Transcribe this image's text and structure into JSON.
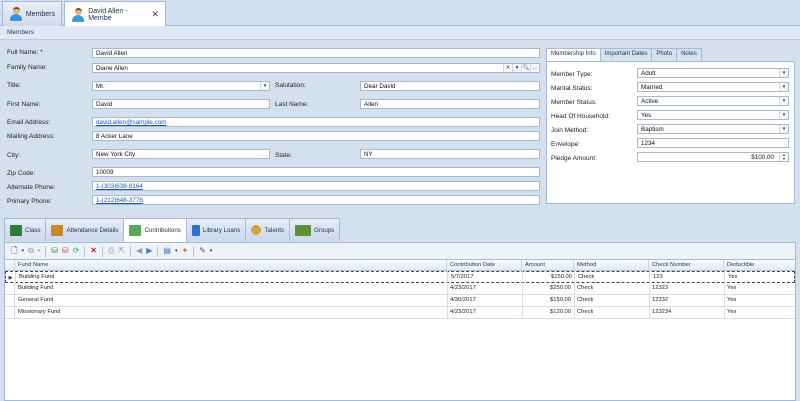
{
  "doc_tabs": [
    {
      "label": "Members",
      "closable": false
    },
    {
      "label": "David Allen - Membe",
      "closable": true,
      "close_glyph": "✕"
    }
  ],
  "breadcrumb": "Members",
  "form": {
    "full_name": {
      "label": "Full Name: *",
      "value": "David Allen"
    },
    "family_name": {
      "label": "Family Name:",
      "value": "Diane Allen",
      "buttons": [
        "✕",
        "▾",
        "🔍",
        "…"
      ]
    },
    "title": {
      "label": "Title:",
      "value": "Mr."
    },
    "salutation": {
      "label": "Salutation:",
      "value": "Dear David"
    },
    "first_name": {
      "label": "First Name:",
      "value": "David"
    },
    "last_name": {
      "label": "Last Name:",
      "value": "Allen"
    },
    "email": {
      "label": "Email Address:",
      "value": "david.allen@sample.com"
    },
    "mailing": {
      "label": "Mailing Address:",
      "value": "8 Acker Lane"
    },
    "city": {
      "label": "City:",
      "value": "New York City"
    },
    "state": {
      "label": "State:",
      "value": "NY"
    },
    "zip": {
      "label": "Zip Code:",
      "value": "10009"
    },
    "alt_phone": {
      "label": "Alternate Phone:",
      "value": "1-(303)638-8164"
    },
    "primary_phone": {
      "label": "Primary Phone:",
      "value": "1-(212)648-3778"
    }
  },
  "membership_tabs": [
    "Membership Info",
    "Important Dates",
    "Photo",
    "Notes"
  ],
  "membership": {
    "member_type": {
      "label": "Member Type:",
      "value": "Adult"
    },
    "marital_status": {
      "label": "Marital Status:",
      "value": "Married"
    },
    "member_status": {
      "label": "Member Status:",
      "value": "Active"
    },
    "head_of_household": {
      "label": "Head Of Household:",
      "value": "Yes"
    },
    "join_method": {
      "label": "Join Method:",
      "value": "Baptism"
    },
    "envelope": {
      "label": "Envelope:",
      "value": "1234"
    },
    "pledge_amount": {
      "label": "Pledge Amount:",
      "value": "$100.00"
    }
  },
  "sub_tabs": [
    {
      "label": "Class",
      "icon": "class-icon",
      "color": "#2f7d3a"
    },
    {
      "label": "Attendance Details",
      "icon": "attendance-icon",
      "color": "#c78a2a"
    },
    {
      "label": "Contributions",
      "icon": "contributions-icon",
      "color": "#58a85a"
    },
    {
      "label": "Library Loans",
      "icon": "library-icon",
      "color": "#2f6fd0"
    },
    {
      "label": "Talents",
      "icon": "talents-icon",
      "color": "#d7a23b"
    },
    {
      "label": "Groups",
      "icon": "groups-icon",
      "color": "#5e8f3c"
    }
  ],
  "grid": {
    "columns": [
      "Fund Name",
      "Contribution Date",
      "Amount",
      "Method",
      "Check Number",
      "Deductible"
    ],
    "rows": [
      {
        "fund": "Building Fund",
        "date": "5/7/2017",
        "amount": "$150.00",
        "method": "Check",
        "check": "123",
        "deductible": "Yes"
      },
      {
        "fund": "Building Fund",
        "date": "4/23/2017",
        "amount": "$250.00",
        "method": "Check",
        "check": "12323",
        "deductible": "Yes"
      },
      {
        "fund": "General Fund",
        "date": "4/30/2017",
        "amount": "$150.00",
        "method": "Check",
        "check": "12332",
        "deductible": "Yes"
      },
      {
        "fund": "Missionary Fund",
        "date": "4/23/2017",
        "amount": "$120.00",
        "method": "Check",
        "check": "123234",
        "deductible": "Yes"
      }
    ],
    "selected_row_glyph": "▶"
  }
}
